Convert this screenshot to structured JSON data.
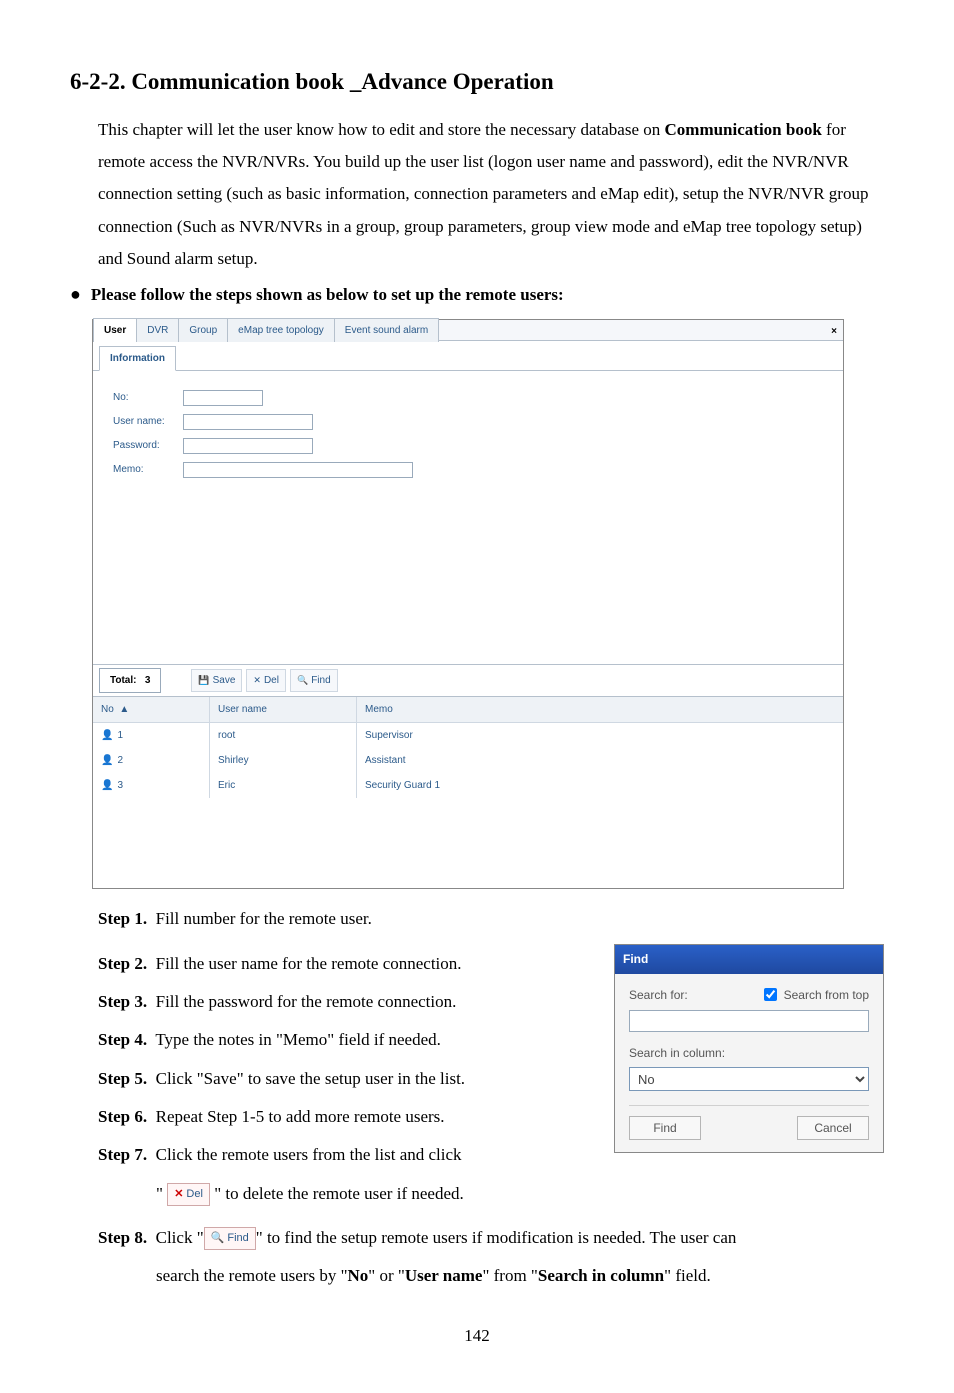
{
  "title": "6-2-2.  Communication book _Advance Operation",
  "intro": {
    "p1a": "This chapter will let the user know how to edit and store the necessary database on ",
    "p1b": "Communication book",
    "p1c": " for remote access the NVR/NVRs.    You build up the user list (logon user name and password), edit the NVR/NVR connection setting (such as basic information, connection parameters and eMap edit), setup the NVR/NVR group connection (Such as NVR/NVRs in a group, group parameters, group view mode and eMap tree topology setup) and Sound alarm setup."
  },
  "bullet": "Please follow the steps shown as below to set up the remote users:",
  "window": {
    "close_glyph": "×",
    "tabs": [
      "User",
      "DVR",
      "Group",
      "eMap tree topology",
      "Event sound alarm"
    ],
    "sub_tab": "Information",
    "form": {
      "no_label": "No:",
      "username_label": "User name:",
      "password_label": "Password:",
      "memo_label": "Memo:"
    },
    "total_label": "Total:",
    "total_value": "3",
    "toolbar": {
      "save": "Save",
      "del": "Del",
      "find": "Find"
    },
    "list": {
      "head": {
        "no": "No",
        "arrow": "▲",
        "username": "User name",
        "memo": "Memo"
      },
      "rows": [
        {
          "no": "1",
          "username": "root",
          "memo": "Supervisor"
        },
        {
          "no": "2",
          "username": "Shirley",
          "memo": "Assistant"
        },
        {
          "no": "3",
          "username": "Eric",
          "memo": "Security Guard 1"
        }
      ]
    }
  },
  "steps": {
    "s1": {
      "label": "Step 1.",
      "text": "Fill number for the remote user."
    },
    "s2": {
      "label": "Step 2.",
      "text": "Fill the user name for the remote connection."
    },
    "s3": {
      "label": "Step 3.",
      "text": "Fill the password for the remote connection."
    },
    "s4": {
      "label": "Step 4.",
      "text": "Type the notes in \"Memo\" field if needed."
    },
    "s5": {
      "label": "Step 5.",
      "text": "Click \"Save\" to save the setup user in the list."
    },
    "s6": {
      "label": "Step 6.",
      "text": "Repeat Step 1-5 to add more remote users."
    },
    "s7": {
      "label": "Step 7.",
      "text_a": "Click the remote users from the list and click ",
      "text_b": "\" to delete the remote user if needed.",
      "quote_open": "\""
    },
    "s8": {
      "label": "Step 8.",
      "a": "Click \"",
      "b": "\" to find the setup remote users if modification is needed. The user can ",
      "c_pre": "search the remote users by \"",
      "no": "No",
      "c_mid1": "\" or \"",
      "un": "User name",
      "c_mid2": "\" from \"",
      "sic": "Search in column",
      "c_end": "\" field."
    }
  },
  "inline_buttons": {
    "del_icon": "✕",
    "del_label": "Del",
    "find_icon": "🔍",
    "find_label": "Find"
  },
  "find_dialog": {
    "title": "Find",
    "search_for": "Search for:",
    "search_from_top": "Search from top",
    "search_in_column": "Search in column:",
    "select_value": "No",
    "find_btn": "Find",
    "cancel_btn": "Cancel"
  },
  "page_number": "142"
}
